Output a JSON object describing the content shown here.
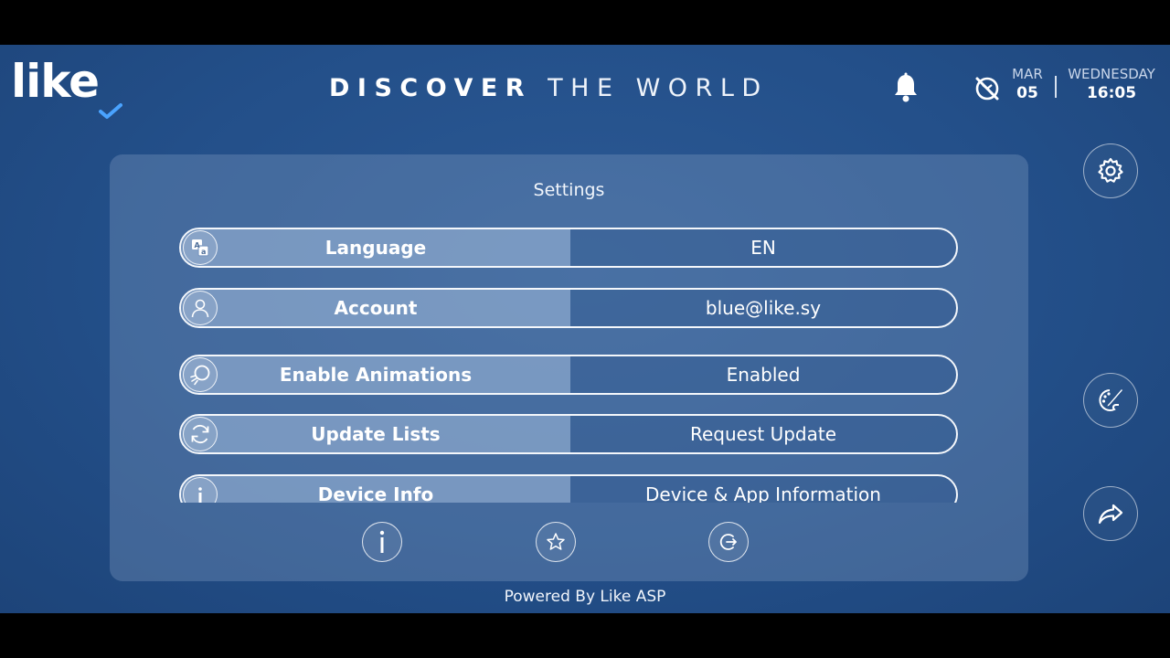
{
  "header": {
    "logo_text": "like",
    "title_bold": "DISCOVER",
    "title_light": "THE WORLD",
    "date": {
      "month": "MAR",
      "day": "05"
    },
    "weekday": "WEDNESDAY",
    "time": "16:05"
  },
  "settings": {
    "title": "Settings",
    "rows": [
      {
        "label": "Language",
        "value": "EN",
        "icon": "translate-icon"
      },
      {
        "label": "Account",
        "value": "blue@like.sy",
        "icon": "user-icon"
      },
      {
        "label": "Enable Animations",
        "value": "Enabled",
        "icon": "animation-icon"
      },
      {
        "label": "Update Lists",
        "value": "Request Update",
        "icon": "refresh-icon"
      },
      {
        "label": "Device Info",
        "value": "Device & App Information",
        "icon": "info-icon"
      }
    ]
  },
  "footer": {
    "text": "Powered By Like ASP"
  },
  "colors": {
    "background": "#234f89",
    "panel": "#5f80ab",
    "accent_check": "#4aa3ff"
  }
}
